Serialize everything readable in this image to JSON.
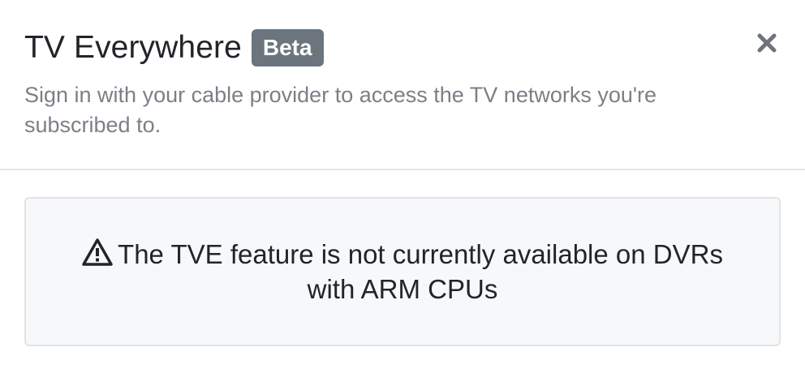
{
  "modal": {
    "title": "TV Everywhere",
    "badge": "Beta",
    "close_icon": "close-icon",
    "subtitle": "Sign in with your cable provider to access the TV networks you're subscribed to."
  },
  "alert": {
    "icon": "warning-icon",
    "message": "The TVE feature is not currently available on DVRs with ARM CPUs"
  },
  "colors": {
    "badge_bg": "#6c757d",
    "alert_bg": "#f7f8fa",
    "subtitle": "#7b8087",
    "text": "#212529"
  }
}
